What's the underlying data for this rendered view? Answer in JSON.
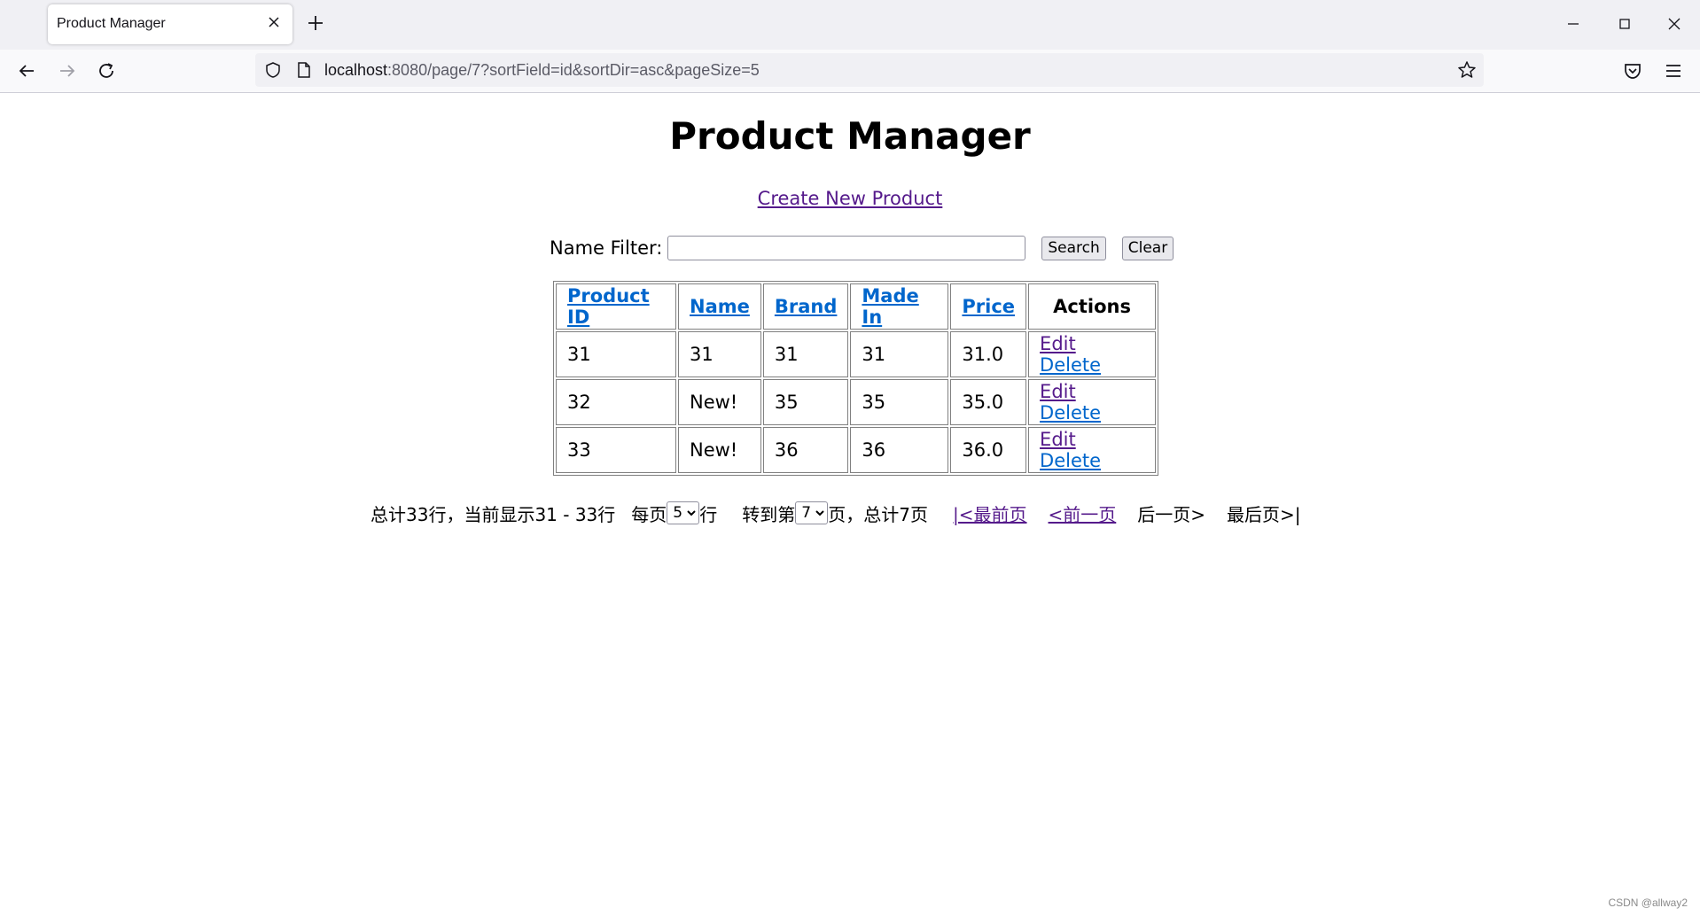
{
  "browser": {
    "tab_title": "Product Manager",
    "url_host": "localhost",
    "url_rest": ":8080/page/7?sortField=id&sortDir=asc&pageSize=5"
  },
  "page": {
    "title": "Product Manager",
    "create_link": "Create New Product",
    "filter": {
      "label": "Name Filter:",
      "value": "",
      "search_label": "Search",
      "clear_label": "Clear"
    },
    "table": {
      "headers": [
        "Product ID",
        "Name",
        "Brand",
        "Made In",
        "Price",
        "Actions"
      ],
      "rows": [
        {
          "id": "31",
          "name": "31",
          "brand": "31",
          "made_in": "31",
          "price": "31.0",
          "edit": "Edit",
          "delete": "Delete"
        },
        {
          "id": "32",
          "name": "New!",
          "brand": "35",
          "made_in": "35",
          "price": "35.0",
          "edit": "Edit",
          "delete": "Delete"
        },
        {
          "id": "33",
          "name": "New!",
          "brand": "36",
          "made_in": "36",
          "price": "36.0",
          "edit": "Edit",
          "delete": "Delete"
        }
      ]
    },
    "pager": {
      "summary": "总计33行，当前显示31 - 33行",
      "per_page_prefix": "每页",
      "per_page_value": "5",
      "per_page_suffix": "行",
      "goto_prefix": "转到第",
      "goto_value": "7",
      "goto_suffix": "页，总计7页",
      "first": "|<最前页",
      "prev": "<前一页",
      "next": "后一页>",
      "last": "最后页>|"
    }
  },
  "watermark": "CSDN @allway2"
}
